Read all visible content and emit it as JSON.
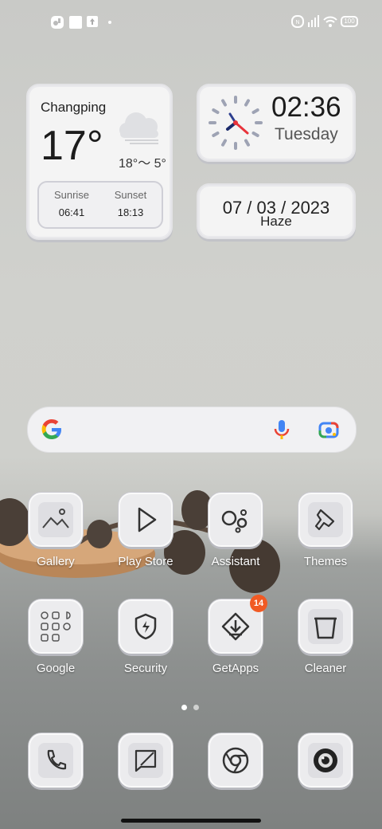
{
  "status_bar": {
    "left_icons": [
      "notification-icon",
      "app-icon",
      "upload-icon",
      "more-dot-icon"
    ],
    "right_icons": [
      "nfc-icon",
      "signal-icon",
      "wifi-icon",
      "battery-icon"
    ],
    "battery": "100"
  },
  "weather": {
    "city": "Changping",
    "temperature": "17°",
    "range": "18°～ 5°",
    "condition_icon": "cloud-icon",
    "sunrise_label": "Sunrise",
    "sunrise_time": "06:41",
    "sunset_label": "Sunset",
    "sunset_time": "18:13"
  },
  "clock": {
    "time": "02:36",
    "day": "Tuesday"
  },
  "date_widget": {
    "date": "07 / 03 / 2023",
    "condition": "Haze"
  },
  "search": {
    "logo": "google-g-icon",
    "voice_icon": "mic-icon",
    "lens_icon": "lens-icon"
  },
  "apps": [
    {
      "label": "Gallery",
      "icon": "gallery-icon"
    },
    {
      "label": "Play Store",
      "icon": "play-store-icon"
    },
    {
      "label": "Assistant",
      "icon": "assistant-icon"
    },
    {
      "label": "Themes",
      "icon": "themes-icon"
    },
    {
      "label": "Google",
      "icon": "google-folder-icon"
    },
    {
      "label": "Security",
      "icon": "security-icon"
    },
    {
      "label": "GetApps",
      "icon": "getapps-icon",
      "badge": "14"
    },
    {
      "label": "Cleaner",
      "icon": "cleaner-icon"
    }
  ],
  "dock": [
    {
      "icon": "phone-icon"
    },
    {
      "icon": "messages-icon"
    },
    {
      "icon": "chrome-icon"
    },
    {
      "icon": "camera-icon"
    }
  ],
  "page_indicator": {
    "pages": 2,
    "current": 1
  }
}
